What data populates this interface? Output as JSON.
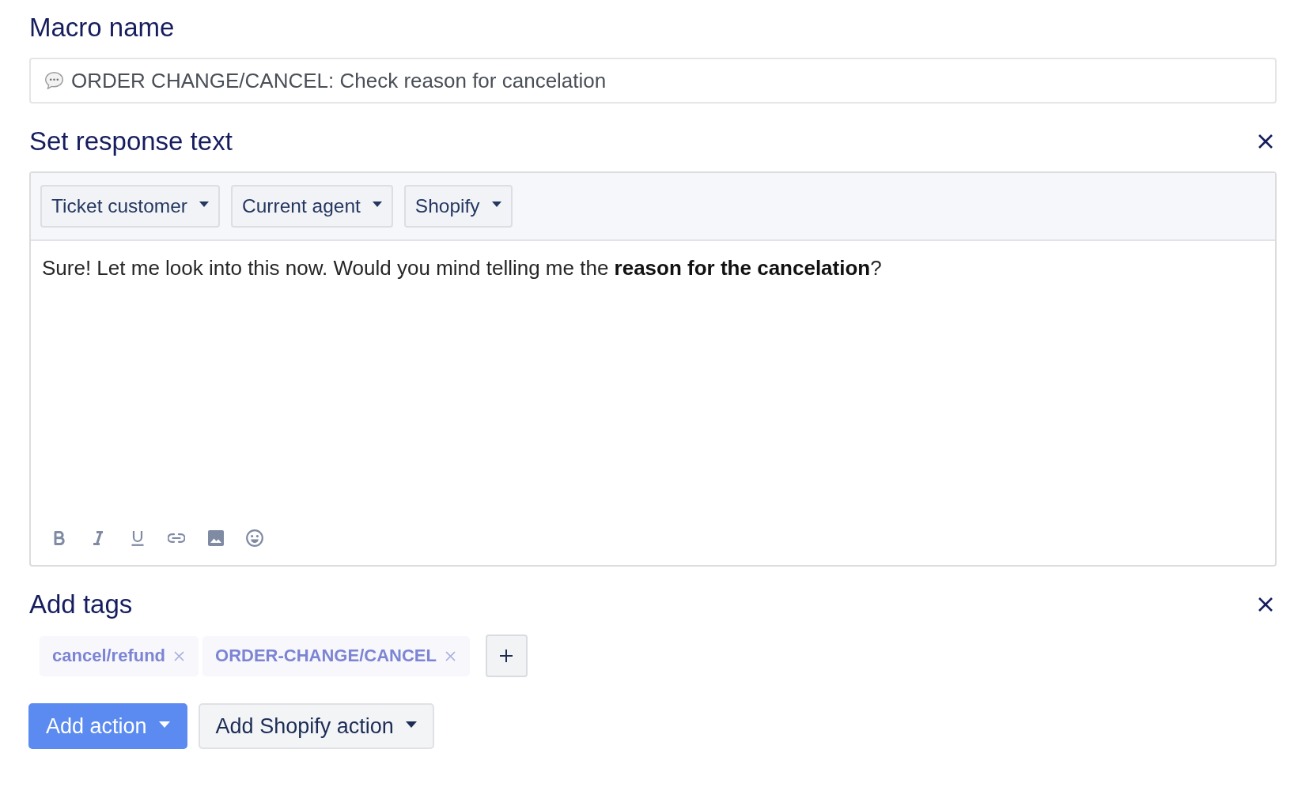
{
  "macro_name": {
    "label": "Macro name",
    "value": "ORDER CHANGE/CANCEL: Check reason for cancelation"
  },
  "response_text": {
    "title": "Set response text",
    "variable_menus": [
      "Ticket customer",
      "Current agent",
      "Shopify"
    ],
    "body": "Sure! Let me look into this now. Would you mind telling me the **reason for the cancelation**?"
  },
  "tags": {
    "title": "Add tags",
    "items": [
      {
        "label": "cancel/refund"
      },
      {
        "label": "ORDER-CHANGE/CANCEL"
      }
    ]
  },
  "action_buttons": [
    {
      "label": "Add action",
      "kind": "primary"
    },
    {
      "label": "Add Shopify action",
      "kind": "secondary"
    }
  ]
}
